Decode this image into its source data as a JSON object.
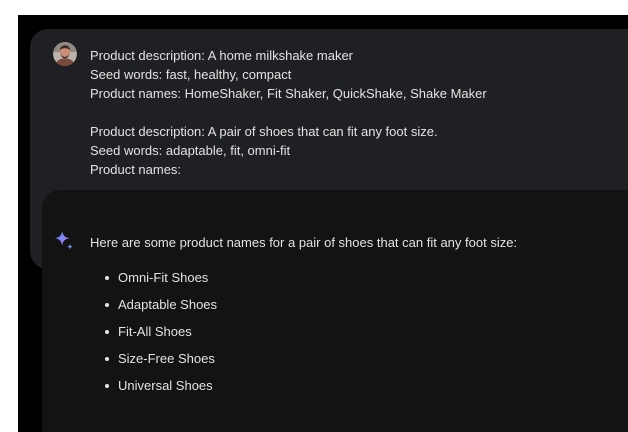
{
  "prompt": {
    "lines": [
      "Product description: A home milkshake maker",
      "Seed words: fast, healthy, compact",
      "Product names: HomeShaker, Fit Shaker, QuickShake, Shake Maker",
      "",
      "Product description: A pair of shoes that can fit any foot size.",
      "Seed words:  adaptable, fit, omni-fit",
      "Product names:"
    ]
  },
  "response": {
    "intro": "Here are some product names for a pair of shoes that can fit any foot size:",
    "items": [
      "Omni-Fit Shoes",
      "Adaptable Shoes",
      "Fit-All Shoes",
      "Size-Free Shoes",
      "Universal Shoes"
    ]
  },
  "icons": {
    "avatar": "user-avatar",
    "assistant": "gemini-sparkle-icon"
  },
  "colors": {
    "background": "#000000",
    "prompt_card": "#1f2023",
    "response_card": "#131314",
    "text": "#e3e3e3",
    "sparkle_blue": "#4f8df5",
    "sparkle_purple": "#b57bee"
  }
}
